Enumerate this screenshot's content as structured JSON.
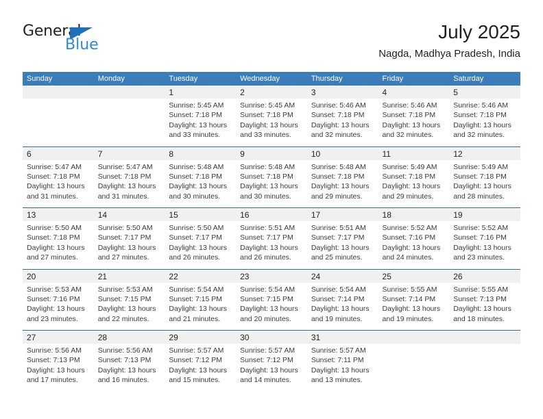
{
  "brand": {
    "name_primary": "General",
    "name_secondary": "Blue",
    "triangle_color": "#1b72b8",
    "secondary_color": "#2e8bd4"
  },
  "header": {
    "title": "July 2025",
    "subtitle": "Nagda, Madhya Pradesh, India"
  },
  "theme": {
    "header_bg": "#3b7cba",
    "header_text": "#ffffff",
    "daynum_bg": "#f0f0f0",
    "separator": "#31669c",
    "body_text": "#3a3a3a"
  },
  "columns": [
    "Sunday",
    "Monday",
    "Tuesday",
    "Wednesday",
    "Thursday",
    "Friday",
    "Saturday"
  ],
  "weeks": [
    {
      "days": [
        {
          "num": "",
          "sunrise": "",
          "sunset": "",
          "daylight": "",
          "empty": true
        },
        {
          "num": "",
          "sunrise": "",
          "sunset": "",
          "daylight": "",
          "empty": true
        },
        {
          "num": "1",
          "sunrise": "Sunrise: 5:45 AM",
          "sunset": "Sunset: 7:18 PM",
          "daylight": "Daylight: 13 hours and 33 minutes.",
          "empty": false
        },
        {
          "num": "2",
          "sunrise": "Sunrise: 5:45 AM",
          "sunset": "Sunset: 7:18 PM",
          "daylight": "Daylight: 13 hours and 33 minutes.",
          "empty": false
        },
        {
          "num": "3",
          "sunrise": "Sunrise: 5:46 AM",
          "sunset": "Sunset: 7:18 PM",
          "daylight": "Daylight: 13 hours and 32 minutes.",
          "empty": false
        },
        {
          "num": "4",
          "sunrise": "Sunrise: 5:46 AM",
          "sunset": "Sunset: 7:18 PM",
          "daylight": "Daylight: 13 hours and 32 minutes.",
          "empty": false
        },
        {
          "num": "5",
          "sunrise": "Sunrise: 5:46 AM",
          "sunset": "Sunset: 7:18 PM",
          "daylight": "Daylight: 13 hours and 32 minutes.",
          "empty": false
        }
      ]
    },
    {
      "days": [
        {
          "num": "6",
          "sunrise": "Sunrise: 5:47 AM",
          "sunset": "Sunset: 7:18 PM",
          "daylight": "Daylight: 13 hours and 31 minutes.",
          "empty": false
        },
        {
          "num": "7",
          "sunrise": "Sunrise: 5:47 AM",
          "sunset": "Sunset: 7:18 PM",
          "daylight": "Daylight: 13 hours and 31 minutes.",
          "empty": false
        },
        {
          "num": "8",
          "sunrise": "Sunrise: 5:48 AM",
          "sunset": "Sunset: 7:18 PM",
          "daylight": "Daylight: 13 hours and 30 minutes.",
          "empty": false
        },
        {
          "num": "9",
          "sunrise": "Sunrise: 5:48 AM",
          "sunset": "Sunset: 7:18 PM",
          "daylight": "Daylight: 13 hours and 30 minutes.",
          "empty": false
        },
        {
          "num": "10",
          "sunrise": "Sunrise: 5:48 AM",
          "sunset": "Sunset: 7:18 PM",
          "daylight": "Daylight: 13 hours and 29 minutes.",
          "empty": false
        },
        {
          "num": "11",
          "sunrise": "Sunrise: 5:49 AM",
          "sunset": "Sunset: 7:18 PM",
          "daylight": "Daylight: 13 hours and 29 minutes.",
          "empty": false
        },
        {
          "num": "12",
          "sunrise": "Sunrise: 5:49 AM",
          "sunset": "Sunset: 7:18 PM",
          "daylight": "Daylight: 13 hours and 28 minutes.",
          "empty": false
        }
      ]
    },
    {
      "days": [
        {
          "num": "13",
          "sunrise": "Sunrise: 5:50 AM",
          "sunset": "Sunset: 7:18 PM",
          "daylight": "Daylight: 13 hours and 27 minutes.",
          "empty": false
        },
        {
          "num": "14",
          "sunrise": "Sunrise: 5:50 AM",
          "sunset": "Sunset: 7:17 PM",
          "daylight": "Daylight: 13 hours and 27 minutes.",
          "empty": false
        },
        {
          "num": "15",
          "sunrise": "Sunrise: 5:50 AM",
          "sunset": "Sunset: 7:17 PM",
          "daylight": "Daylight: 13 hours and 26 minutes.",
          "empty": false
        },
        {
          "num": "16",
          "sunrise": "Sunrise: 5:51 AM",
          "sunset": "Sunset: 7:17 PM",
          "daylight": "Daylight: 13 hours and 26 minutes.",
          "empty": false
        },
        {
          "num": "17",
          "sunrise": "Sunrise: 5:51 AM",
          "sunset": "Sunset: 7:17 PM",
          "daylight": "Daylight: 13 hours and 25 minutes.",
          "empty": false
        },
        {
          "num": "18",
          "sunrise": "Sunrise: 5:52 AM",
          "sunset": "Sunset: 7:16 PM",
          "daylight": "Daylight: 13 hours and 24 minutes.",
          "empty": false
        },
        {
          "num": "19",
          "sunrise": "Sunrise: 5:52 AM",
          "sunset": "Sunset: 7:16 PM",
          "daylight": "Daylight: 13 hours and 23 minutes.",
          "empty": false
        }
      ]
    },
    {
      "days": [
        {
          "num": "20",
          "sunrise": "Sunrise: 5:53 AM",
          "sunset": "Sunset: 7:16 PM",
          "daylight": "Daylight: 13 hours and 23 minutes.",
          "empty": false
        },
        {
          "num": "21",
          "sunrise": "Sunrise: 5:53 AM",
          "sunset": "Sunset: 7:15 PM",
          "daylight": "Daylight: 13 hours and 22 minutes.",
          "empty": false
        },
        {
          "num": "22",
          "sunrise": "Sunrise: 5:54 AM",
          "sunset": "Sunset: 7:15 PM",
          "daylight": "Daylight: 13 hours and 21 minutes.",
          "empty": false
        },
        {
          "num": "23",
          "sunrise": "Sunrise: 5:54 AM",
          "sunset": "Sunset: 7:15 PM",
          "daylight": "Daylight: 13 hours and 20 minutes.",
          "empty": false
        },
        {
          "num": "24",
          "sunrise": "Sunrise: 5:54 AM",
          "sunset": "Sunset: 7:14 PM",
          "daylight": "Daylight: 13 hours and 19 minutes.",
          "empty": false
        },
        {
          "num": "25",
          "sunrise": "Sunrise: 5:55 AM",
          "sunset": "Sunset: 7:14 PM",
          "daylight": "Daylight: 13 hours and 19 minutes.",
          "empty": false
        },
        {
          "num": "26",
          "sunrise": "Sunrise: 5:55 AM",
          "sunset": "Sunset: 7:13 PM",
          "daylight": "Daylight: 13 hours and 18 minutes.",
          "empty": false
        }
      ]
    },
    {
      "days": [
        {
          "num": "27",
          "sunrise": "Sunrise: 5:56 AM",
          "sunset": "Sunset: 7:13 PM",
          "daylight": "Daylight: 13 hours and 17 minutes.",
          "empty": false
        },
        {
          "num": "28",
          "sunrise": "Sunrise: 5:56 AM",
          "sunset": "Sunset: 7:13 PM",
          "daylight": "Daylight: 13 hours and 16 minutes.",
          "empty": false
        },
        {
          "num": "29",
          "sunrise": "Sunrise: 5:57 AM",
          "sunset": "Sunset: 7:12 PM",
          "daylight": "Daylight: 13 hours and 15 minutes.",
          "empty": false
        },
        {
          "num": "30",
          "sunrise": "Sunrise: 5:57 AM",
          "sunset": "Sunset: 7:12 PM",
          "daylight": "Daylight: 13 hours and 14 minutes.",
          "empty": false
        },
        {
          "num": "31",
          "sunrise": "Sunrise: 5:57 AM",
          "sunset": "Sunset: 7:11 PM",
          "daylight": "Daylight: 13 hours and 13 minutes.",
          "empty": false
        },
        {
          "num": "",
          "sunrise": "",
          "sunset": "",
          "daylight": "",
          "empty": true
        },
        {
          "num": "",
          "sunrise": "",
          "sunset": "",
          "daylight": "",
          "empty": true
        }
      ]
    }
  ]
}
